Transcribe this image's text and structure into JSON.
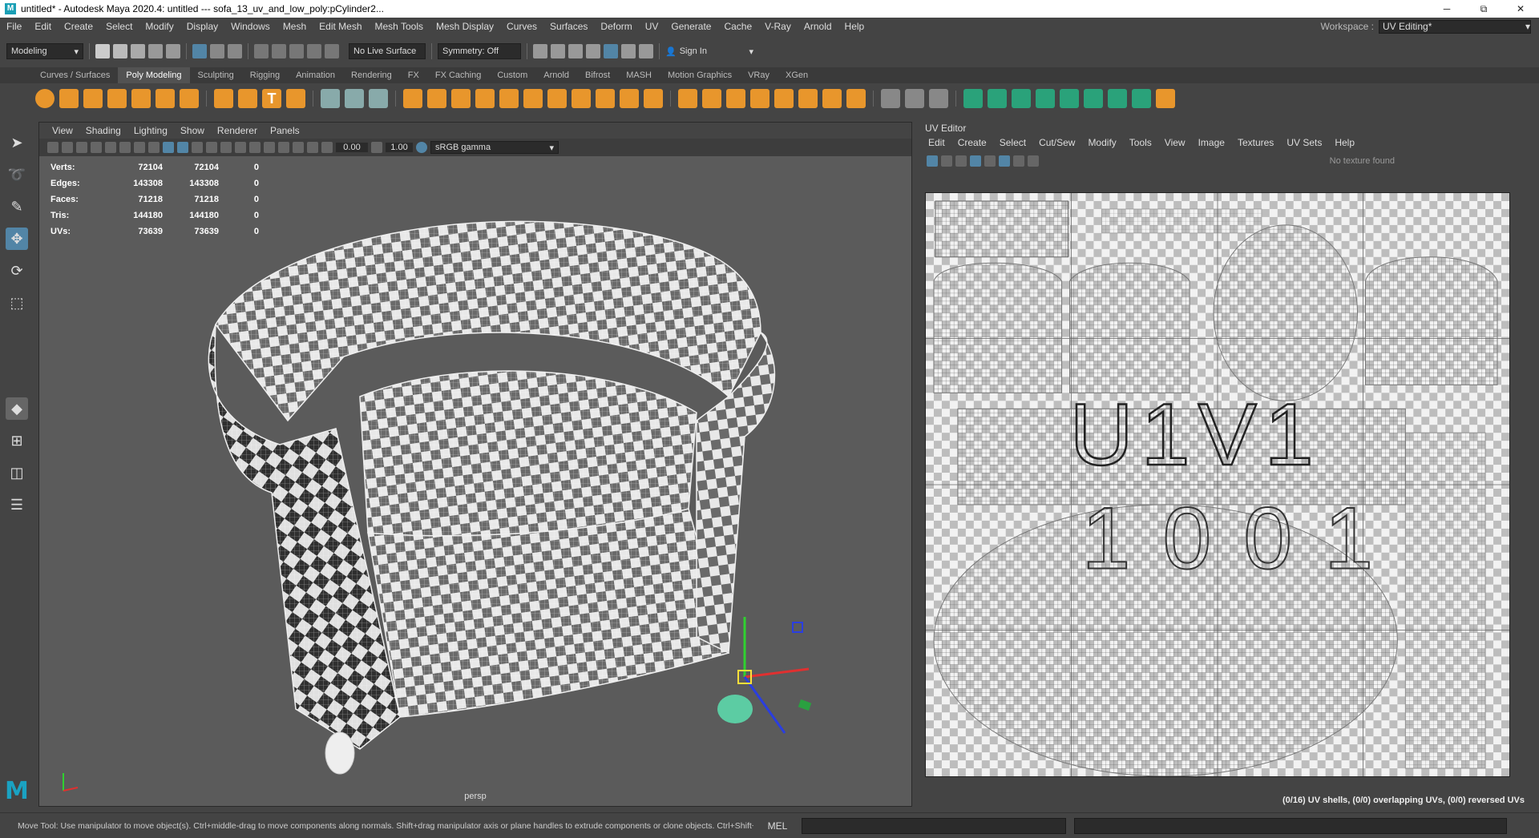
{
  "window": {
    "title": "untitled* - Autodesk Maya 2020.4: untitled   ---   sofa_13_uv_and_low_poly:pCylinder2...",
    "minimize": "─",
    "maximize": "⧉",
    "close": "✕"
  },
  "menubar": {
    "items": [
      "File",
      "Edit",
      "Create",
      "Select",
      "Modify",
      "Display",
      "Windows",
      "Mesh",
      "Edit Mesh",
      "Mesh Tools",
      "Mesh Display",
      "Curves",
      "Surfaces",
      "Deform",
      "UV",
      "Generate",
      "Cache",
      "V-Ray",
      "Arnold",
      "Help"
    ],
    "workspace_label": "Workspace :",
    "workspace_value": "UV Editing*"
  },
  "statusline": {
    "menuset": "Modeling",
    "live_surface": "No Live Surface",
    "symmetry": "Symmetry: Off",
    "sign_in": "Sign In"
  },
  "shelf": {
    "tabs": [
      "Curves / Surfaces",
      "Poly Modeling",
      "Sculpting",
      "Rigging",
      "Animation",
      "Rendering",
      "FX",
      "FX Caching",
      "Custom",
      "Arnold",
      "Bifrost",
      "MASH",
      "Motion Graphics",
      "VRay",
      "XGen"
    ],
    "active_tab": "Poly Modeling"
  },
  "viewport": {
    "menu": [
      "View",
      "Shading",
      "Lighting",
      "Show",
      "Renderer",
      "Panels"
    ],
    "exposure": "0.00",
    "gamma": "1.00",
    "colorspace": "sRGB gamma",
    "hud": [
      {
        "label": "Verts:",
        "a": "72104",
        "b": "72104",
        "c": "0"
      },
      {
        "label": "Edges:",
        "a": "143308",
        "b": "143308",
        "c": "0"
      },
      {
        "label": "Faces:",
        "a": "71218",
        "b": "71218",
        "c": "0"
      },
      {
        "label": "Tris:",
        "a": "144180",
        "b": "144180",
        "c": "0"
      },
      {
        "label": "UVs:",
        "a": "73639",
        "b": "73639",
        "c": "0"
      }
    ],
    "camera": "persp"
  },
  "uv_editor": {
    "title": "UV Editor",
    "menu": [
      "Edit",
      "Create",
      "Select",
      "Cut/Sew",
      "Modify",
      "Tools",
      "View",
      "Image",
      "Textures",
      "UV Sets",
      "Help"
    ],
    "texture_status": "No texture found",
    "tile_label_top": "U1V1",
    "tile_label_bottom": "1001",
    "status": "(0/16) UV shells, (0/0) overlapping UVs, (0/0) reversed UVs"
  },
  "helpline": {
    "message": "Move Tool: Use manipulator to move object(s). Ctrl+middle-drag to move components along normals. Shift+drag manipulator axis or plane handles to extrude components or clone objects. Ctrl+Shift+drag to con",
    "mel_label": "MEL"
  },
  "colors": {
    "accent": "#5285a6",
    "orange": "#e8962c",
    "teal": "#2aa27a"
  }
}
